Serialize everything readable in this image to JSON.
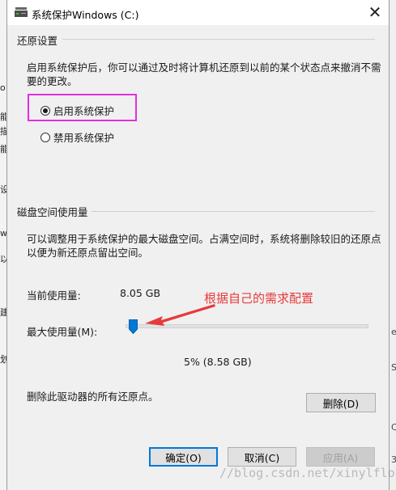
{
  "window": {
    "title": "系统保护Windows (C:)",
    "close_glyph": "✕"
  },
  "restore_settings": {
    "heading": "还原设置",
    "description_line1": "启用系统保护后，你可以通过及时将计算机还原到以前的某个状态点来撤消不需",
    "description_line2": "要的更改。",
    "options": [
      {
        "label": "启用系统保护",
        "selected": true
      },
      {
        "label": "禁用系统保护",
        "selected": false
      }
    ]
  },
  "disk_usage": {
    "heading": "磁盘空间使用量",
    "description_line1": "可以调整用于系统保护的最大磁盘空间。占满空间时，系统将删除较旧的还原点",
    "description_line2": "以便为新还原点留出空间。",
    "current_label": "当前使用量:",
    "current_value": "8.05 GB",
    "max_label": "最大使用量(M):",
    "max_percent": 5,
    "max_value_text": "5% (8.58 GB)",
    "delete_text": "删除此驱动器的所有还原点。",
    "delete_button": "删除(D)"
  },
  "annotation": {
    "text": "根据自己的需求配置",
    "color": "#e83a3a",
    "highlight_color": "#e030e0"
  },
  "footer": {
    "ok": "确定(O)",
    "cancel": "取消(C)",
    "apply": "应用(A)"
  },
  "watermark": "//blog.csdn.net/xinylflove",
  "background_window": {
    "left_fragments": [
      "o",
      "能",
      "描",
      "能",
      "设",
      "w",
      "以",
      "建",
      "划"
    ],
    "right_fragments": [
      "e",
      "S",
      "C",
      "3"
    ]
  },
  "colors": {
    "accent": "#0078d7",
    "dialog_bg": "#f0f0f0"
  }
}
